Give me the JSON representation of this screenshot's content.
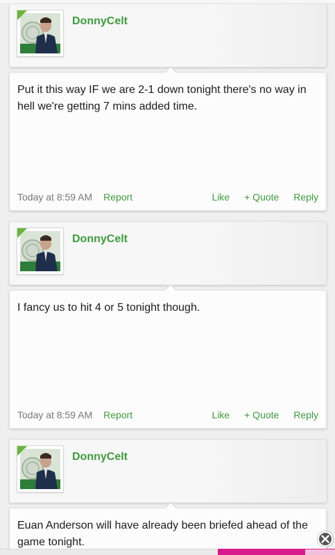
{
  "posts": [
    {
      "username": "DonnyCelt",
      "message": "Put it this way IF we are 2-1 down tonight there's no way in hell we're getting 7 mins added time.",
      "timestamp": "Today at 8:59 AM",
      "report_label": "Report",
      "like_label": "Like",
      "quote_label": "+ Quote",
      "reply_label": "Reply"
    },
    {
      "username": "DonnyCelt",
      "message": "I fancy us to hit 4 or 5 tonight though.",
      "timestamp": "Today at 8:59 AM",
      "report_label": "Report",
      "like_label": "Like",
      "quote_label": "+ Quote",
      "reply_label": "Reply"
    },
    {
      "username": "DonnyCelt",
      "message": "Euan Anderson will have already been briefed ahead of the game tonight."
    }
  ],
  "colors": {
    "link_green": "#3f9a3f",
    "avatar_corner": "#6ab43e",
    "ad_pink": "#d81b8c"
  },
  "icons": {
    "avatar": "celtic-manager-avatar",
    "close": "close-icon"
  }
}
